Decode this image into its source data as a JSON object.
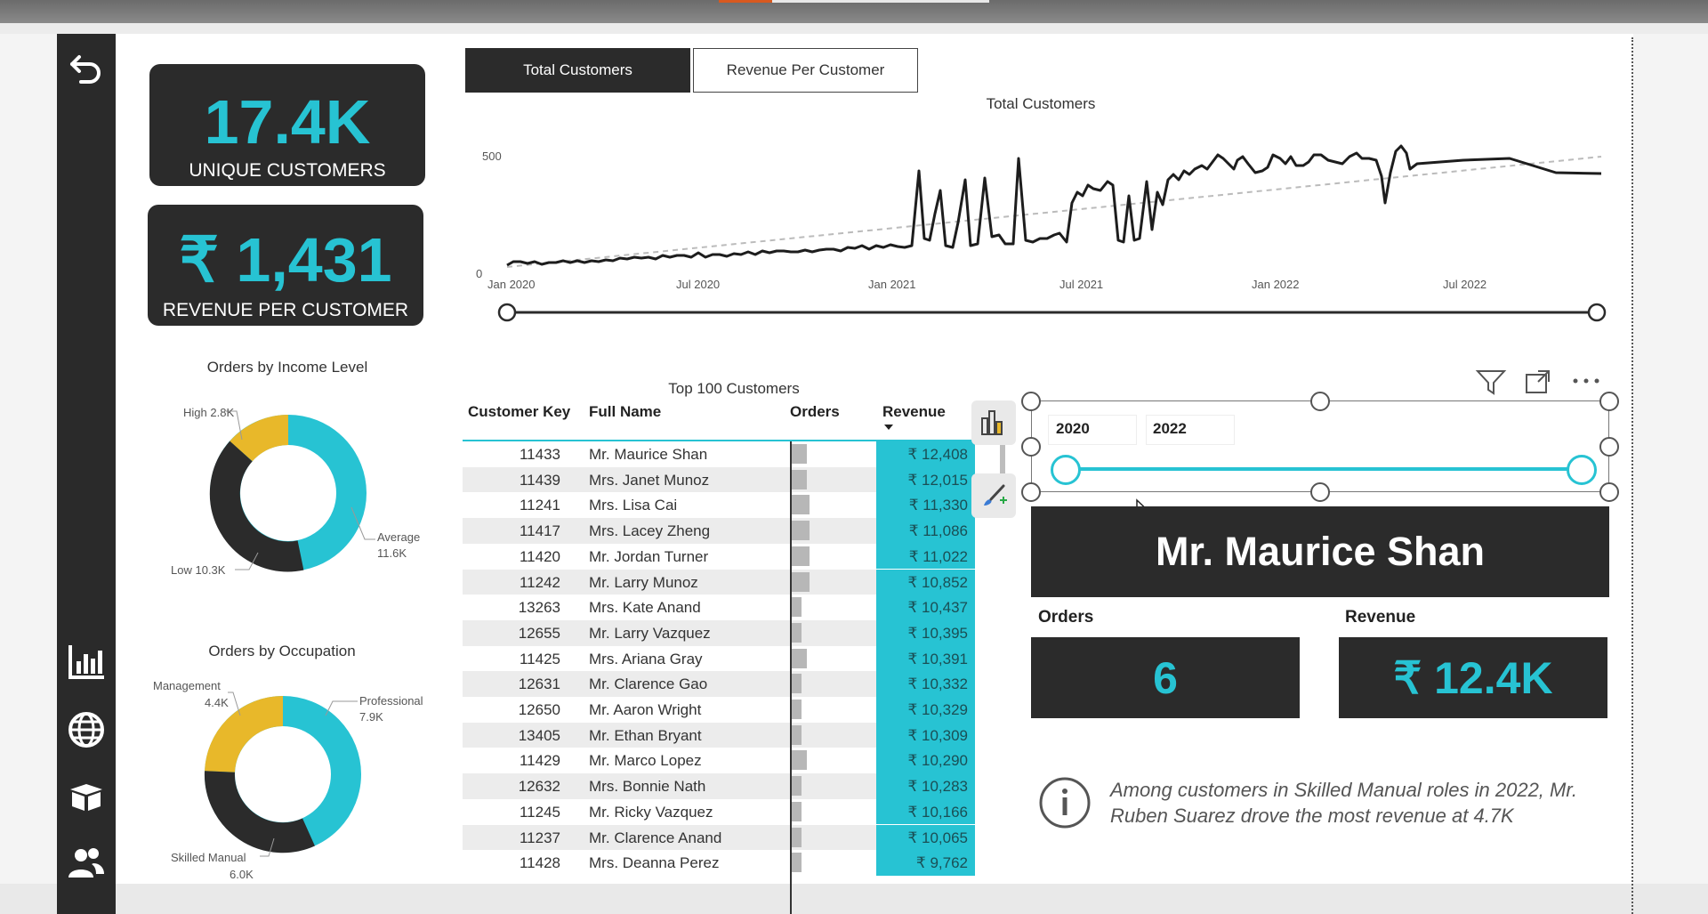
{
  "kpis": {
    "unique_customers": {
      "value": "17.4K",
      "label": "UNIQUE CUSTOMERS"
    },
    "revenue_per_customer": {
      "value": "₹ 1,431",
      "label": "REVENUE PER CUSTOMER"
    }
  },
  "donut_income": {
    "title": "Orders by Income Level",
    "labels": [
      {
        "name": "High",
        "value": "2.8K"
      },
      {
        "name": "Average",
        "value": "11.6K"
      },
      {
        "name": "Low",
        "value": "10.3K"
      }
    ]
  },
  "donut_occupation": {
    "title": "Orders by Occupation",
    "labels": [
      {
        "name": "Management",
        "value": "4.4K"
      },
      {
        "name": "Professional",
        "value": "7.9K"
      },
      {
        "name": "Skilled Manual",
        "value": "6.0K"
      }
    ]
  },
  "tabs": [
    {
      "label": "Total Customers",
      "active": true
    },
    {
      "label": "Revenue Per Customer",
      "active": false
    }
  ],
  "line_chart": {
    "title": "Total Customers",
    "y_ticks": [
      "500",
      "0"
    ],
    "x_ticks": [
      "Jan 2020",
      "Jul 2020",
      "Jan 2021",
      "Jul 2021",
      "Jan 2022",
      "Jul 2022"
    ]
  },
  "table": {
    "title": "Top 100 Customers",
    "headers": {
      "key": "Customer Key",
      "name": "Full Name",
      "orders": "Orders",
      "revenue": "Revenue"
    },
    "rows": [
      {
        "key": "11433",
        "name": "Mr. Maurice Shan",
        "orders": "6",
        "revenue": "₹ 12,408"
      },
      {
        "key": "11439",
        "name": "Mrs. Janet Munoz",
        "orders": "6",
        "revenue": "₹ 12,015"
      },
      {
        "key": "11241",
        "name": "Mrs. Lisa Cai",
        "orders": "7",
        "revenue": "₹ 11,330"
      },
      {
        "key": "11417",
        "name": "Mrs. Lacey Zheng",
        "orders": "7",
        "revenue": "₹ 11,086"
      },
      {
        "key": "11420",
        "name": "Mr. Jordan Turner",
        "orders": "7",
        "revenue": "₹ 11,022"
      },
      {
        "key": "11242",
        "name": "Mr. Larry Munoz",
        "orders": "7",
        "revenue": "₹ 10,852"
      },
      {
        "key": "13263",
        "name": "Mrs. Kate Anand",
        "orders": "4",
        "revenue": "₹ 10,437"
      },
      {
        "key": "12655",
        "name": "Mr. Larry Vazquez",
        "orders": "4",
        "revenue": "₹ 10,395"
      },
      {
        "key": "11425",
        "name": "Mrs. Ariana Gray",
        "orders": "6",
        "revenue": "₹ 10,391"
      },
      {
        "key": "12631",
        "name": "Mr. Clarence Gao",
        "orders": "4",
        "revenue": "₹ 10,332"
      },
      {
        "key": "12650",
        "name": "Mr. Aaron Wright",
        "orders": "4",
        "revenue": "₹ 10,329"
      },
      {
        "key": "13405",
        "name": "Mr. Ethan Bryant",
        "orders": "4",
        "revenue": "₹ 10,309"
      },
      {
        "key": "11429",
        "name": "Mr. Marco Lopez",
        "orders": "6",
        "revenue": "₹ 10,290"
      },
      {
        "key": "12632",
        "name": "Mrs. Bonnie Nath",
        "orders": "4",
        "revenue": "₹ 10,283"
      },
      {
        "key": "11245",
        "name": "Mr. Ricky Vazquez",
        "orders": "4",
        "revenue": "₹ 10,166"
      },
      {
        "key": "11237",
        "name": "Mr. Clarence Anand",
        "orders": "4",
        "revenue": "₹ 10,065"
      },
      {
        "key": "11428",
        "name": "Mrs. Deanna Perez",
        "orders": "4",
        "revenue": "₹ 9,762"
      }
    ]
  },
  "slicer": {
    "start": "2020",
    "end": "2022"
  },
  "detail": {
    "name": "Mr. Maurice Shan",
    "orders_label": "Orders",
    "orders_value": "6",
    "revenue_label": "Revenue",
    "revenue_value": "₹ 12.4K"
  },
  "note": "Among customers in Skilled Manual roles in 2022, Mr. Ruben Suarez drove the most revenue at 4.7K",
  "colors": {
    "accent": "#27c3d3",
    "dark": "#2b2b2b",
    "gold": "#e8b82a"
  },
  "icons": [
    "back-icon",
    "bar-chart-icon",
    "globe-icon",
    "box-icon",
    "users-icon",
    "filter-icon",
    "focus-mode-icon",
    "more-options-icon",
    "build-visual-icon",
    "format-brush-icon",
    "info-icon"
  ]
}
